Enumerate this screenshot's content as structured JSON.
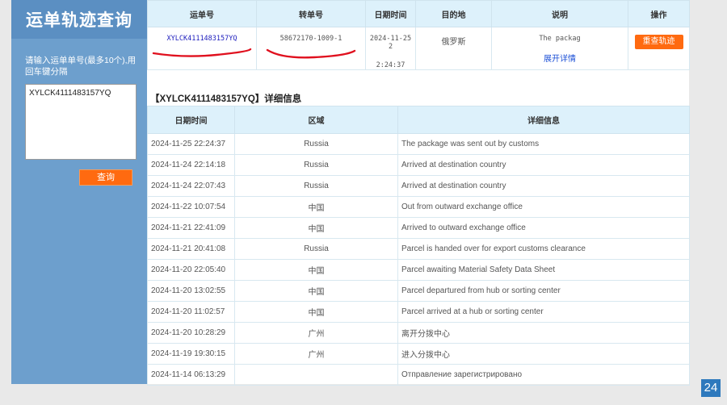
{
  "sidebar": {
    "title": "运单轨迹查询",
    "hint": "请输入运单单号(最多10个),用回车键分隔",
    "textarea_value": "XYLCK4111483157YQ",
    "query_button": "查询"
  },
  "summary": {
    "headers": [
      "运单号",
      "转单号",
      "日期时间",
      "目的地",
      "说明",
      "操作"
    ],
    "waybill_no": "XYLCK4111483157YQ",
    "transfer_no": "58672170-1009-1",
    "datetime_line1": "2024-11-25 2",
    "datetime_line2": "2:24:37",
    "destination": "俄罗斯",
    "note": "The packag",
    "expand_link": "展开详情",
    "reset_button": "重查轨迹",
    "annotation_color": "#e0101e"
  },
  "detail": {
    "title": "【XYLCK4111483157YQ】详细信息",
    "headers": [
      "日期时间",
      "区域",
      "详细信息"
    ],
    "rows": [
      {
        "time": "2024-11-25 22:24:37",
        "area": "Russia",
        "info": "The package was sent out by customs"
      },
      {
        "time": "2024-11-24 22:14:18",
        "area": "Russia",
        "info": "Arrived at destination country"
      },
      {
        "time": "2024-11-24 22:07:43",
        "area": "Russia",
        "info": "Arrived at destination country"
      },
      {
        "time": "2024-11-22 10:07:54",
        "area": "中国",
        "info": "Out from outward exchange office"
      },
      {
        "time": "2024-11-21 22:41:09",
        "area": "中国",
        "info": "Arrived to outward exchange office"
      },
      {
        "time": "2024-11-21 20:41:08",
        "area": "Russia",
        "info": "Parcel is handed over for export customs clearance"
      },
      {
        "time": "2024-11-20 22:05:40",
        "area": "中国",
        "info": "Parcel awaiting Material Safety Data Sheet"
      },
      {
        "time": "2024-11-20 13:02:55",
        "area": "中国",
        "info": "Parcel departured from hub or sorting center"
      },
      {
        "time": "2024-11-20 11:02:57",
        "area": "中国",
        "info": "Parcel arrived at a hub or sorting center"
      },
      {
        "time": "2024-11-20 10:28:29",
        "area": "广州",
        "info": "离开分拨中心"
      },
      {
        "time": "2024-11-19 19:30:15",
        "area": "广州",
        "info": "进入分拨中心"
      },
      {
        "time": "2024-11-14 06:13:29",
        "area": "",
        "info": "Отправление зарегистрировано"
      }
    ]
  },
  "corner_badge": "24"
}
